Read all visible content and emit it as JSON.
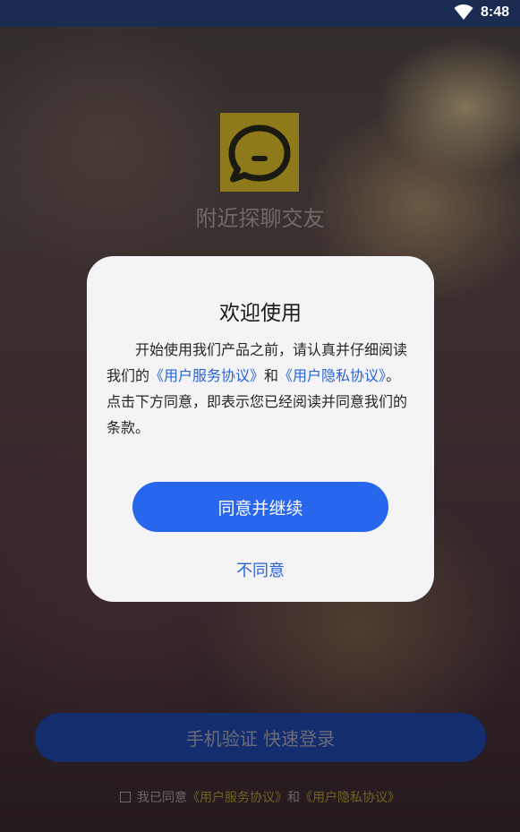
{
  "status_bar": {
    "time": "8:48",
    "icons": [
      "wifi-icon"
    ]
  },
  "app": {
    "logo_icon": "chat-bubble-icon",
    "name": "附近探聊交友"
  },
  "login": {
    "button_label": "手机验证 快速登录",
    "agreement": {
      "prefix": "我已同意",
      "service_link": "《用户服务协议》",
      "and": "和",
      "privacy_link": "《用户隐私协议》"
    }
  },
  "dialog": {
    "title": "欢迎使用",
    "body": {
      "part1": "开始使用我们产品之前，请认真并仔细阅读我们的",
      "service_link": "《用户服务协议》",
      "and": "和",
      "privacy_link": "《用户隐私协议》",
      "part2": "。点击下方同意，即表示您已经阅读并同意我们的条款。"
    },
    "agree_button": "同意并继续",
    "disagree_button": "不同意"
  },
  "colors": {
    "primary": "#2866ee",
    "link": "#2a63d8",
    "status_bar": "#1b2c52"
  }
}
